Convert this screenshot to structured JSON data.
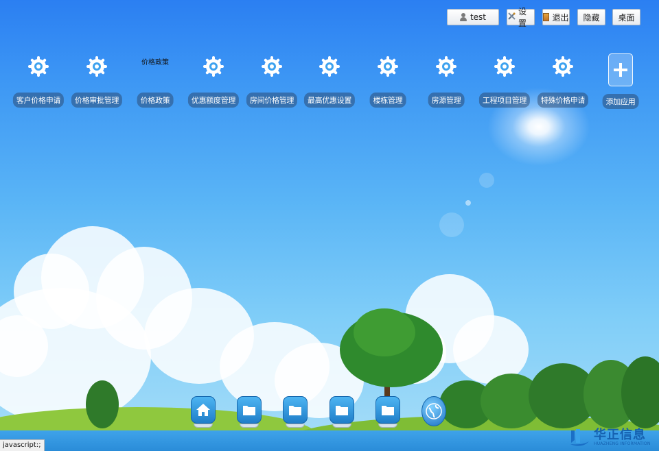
{
  "topbar": {
    "user_label": "test",
    "settings_label": "设置",
    "logout_label": "退出",
    "hide_label": "隐藏",
    "desktop_label": "桌面"
  },
  "apps": [
    {
      "label": "客户价格申请",
      "icon": "gear-icon"
    },
    {
      "label": "价格审批管理",
      "icon": "gear-icon"
    },
    {
      "label": "价格政策",
      "icon": "broken-image",
      "alt_text": "价格政策"
    },
    {
      "label": "优惠额度管理",
      "icon": "gear-icon"
    },
    {
      "label": "房间价格管理",
      "icon": "gear-icon"
    },
    {
      "label": "最高优惠设置",
      "icon": "gear-icon"
    },
    {
      "label": "楼栋管理",
      "icon": "gear-icon"
    },
    {
      "label": "房源管理",
      "icon": "gear-icon"
    },
    {
      "label": "工程项目管理",
      "icon": "gear-icon"
    },
    {
      "label": "特殊价格申请",
      "icon": "gear-icon"
    },
    {
      "label": "添加应用",
      "icon": "plus-icon"
    }
  ],
  "dock": [
    {
      "icon": "home-icon"
    },
    {
      "icon": "folder-icon"
    },
    {
      "icon": "folder-icon"
    },
    {
      "icon": "folder-icon"
    },
    {
      "icon": "folder-icon"
    },
    {
      "icon": "globe-icon"
    }
  ],
  "status_bar": {
    "text": "javascript:;"
  },
  "brand": {
    "name": "华正信息",
    "subtitle": "HUAZHENG INFORMATION"
  },
  "colors": {
    "sky_top": "#2b7ff2",
    "sky_bottom": "#a8def8",
    "label_bg": "#283c5a",
    "brand": "#1561b0"
  }
}
